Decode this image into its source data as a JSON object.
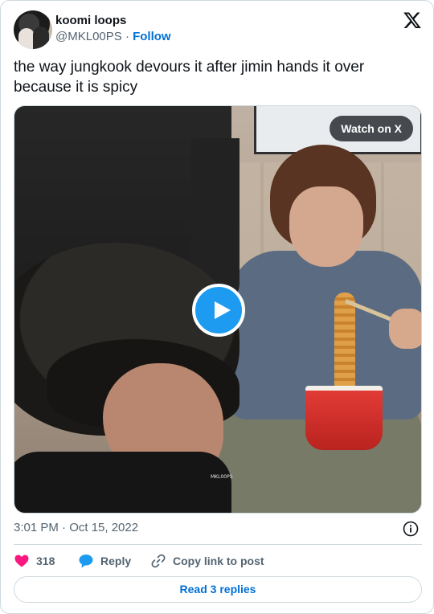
{
  "author": {
    "display_name": "koomi loops",
    "handle": "@MKL00PS",
    "separator": "·",
    "follow_label": "Follow"
  },
  "tweet": {
    "text": "the way jungkook devours it after jimin hands it over because it is spicy",
    "timestamp": "3:01 PM · Oct 15, 2022"
  },
  "media": {
    "watch_label": "Watch on X",
    "watermark": "MKL00PS"
  },
  "actions": {
    "like_count": "318",
    "reply_label": "Reply",
    "copy_label": "Copy link to post"
  },
  "read_replies_label": "Read 3 replies",
  "colors": {
    "accent": "#1d9bf0",
    "link": "#006fd6",
    "like": "#f91880",
    "muted": "#536471",
    "border": "#cfd9de"
  },
  "icons": [
    "x-logo-icon",
    "play-icon",
    "info-icon",
    "heart-icon",
    "reply-bubble-icon",
    "link-icon"
  ]
}
